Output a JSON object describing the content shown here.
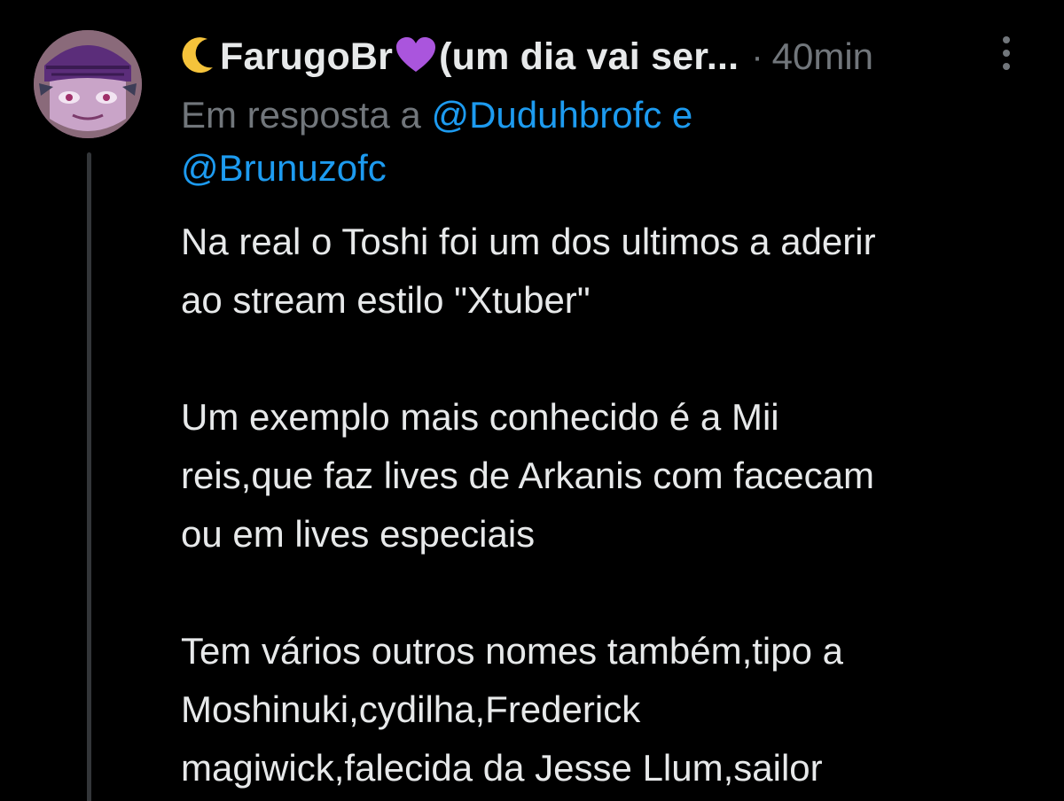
{
  "tweet": {
    "display_name": "FarugoBr",
    "name_suffix": "(um dia vai ser...",
    "separator": "·",
    "timestamp": "40min",
    "reply_prefix": "Em resposta a",
    "mention_1": "@Duduhbrofc",
    "reply_conjunction": "e",
    "mention_2": "@Brunuzofc",
    "paragraphs": [
      [
        "Na real o Toshi foi um dos ultimos a aderir",
        "ao stream estilo \"Xtuber\""
      ],
      [
        "Um exemplo mais conhecido é a Mii",
        "reis,que faz lives de Arkanis com facecam",
        "ou em lives especiais"
      ],
      [
        "Tem vários outros nomes também,tipo a",
        "Moshinuki,cydilha,Frederick",
        "magiwick,falecida da Jesse Llum,sailor"
      ]
    ]
  },
  "icons": {
    "name_emoji_1": "crescent-moon-icon",
    "name_emoji_2": "purple-heart-icon",
    "menu": "more-vertical-icon"
  },
  "colors": {
    "background": "#000000",
    "primary_text": "#e7e9ea",
    "secondary_text": "#71767b",
    "link": "#1d9bf0",
    "heart": "#aa55dd",
    "moon": "#f5c33b"
  }
}
